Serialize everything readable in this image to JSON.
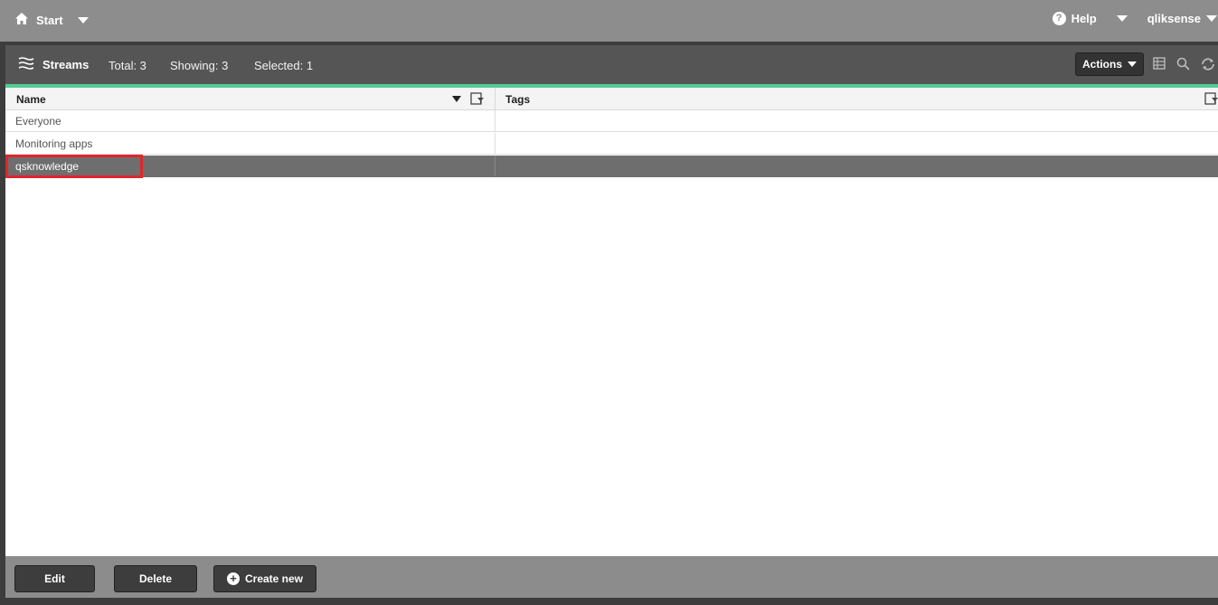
{
  "topbar": {
    "start_label": "Start",
    "help_label": "Help",
    "user_label": "qliksense"
  },
  "header": {
    "title": "Streams",
    "total": "Total: 3",
    "showing": "Showing: 3",
    "selected": "Selected: 1",
    "actions_label": "Actions"
  },
  "table": {
    "columns": [
      "Name",
      "Tags"
    ],
    "rows": [
      {
        "name": "Everyone",
        "tags": ""
      },
      {
        "name": "Monitoring apps",
        "tags": ""
      },
      {
        "name": "qsknowledge",
        "tags": "",
        "selected": true
      }
    ]
  },
  "footer": {
    "edit_label": "Edit",
    "delete_label": "Delete",
    "create_label": "Create new"
  },
  "colors": {
    "accent": "#52cc94",
    "selected_row": "#6e6e6e",
    "highlight": "#e0262c"
  }
}
